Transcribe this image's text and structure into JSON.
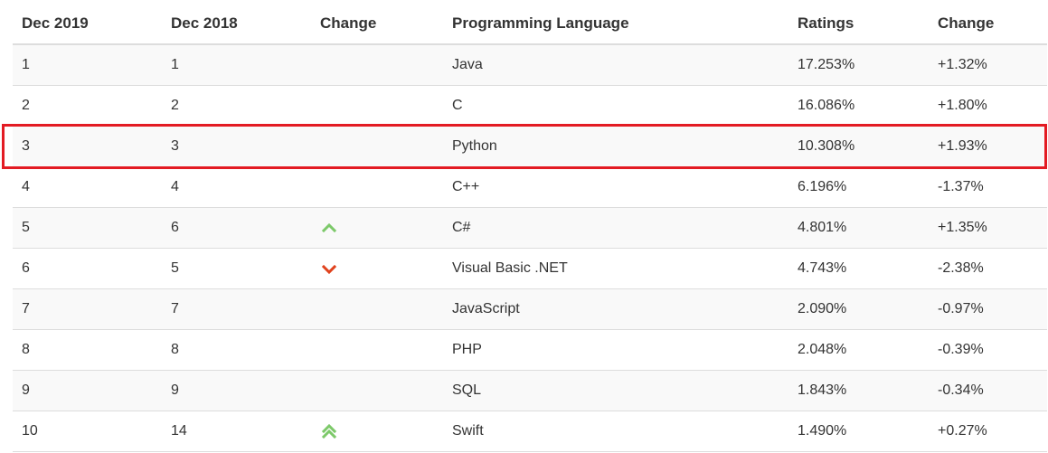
{
  "header": {
    "col1": "Dec 2019",
    "col2": "Dec 2018",
    "col3": "Change",
    "col4": "Programming Language",
    "col5": "Ratings",
    "col6": "Change"
  },
  "colors": {
    "highlight_border": "#e31b23",
    "up_arrow": "#7dc96a",
    "down_arrow": "#e0421d"
  },
  "rows": [
    {
      "rank2019": "1",
      "rank2018": "1",
      "trend": "none",
      "language": "Java",
      "rating": "17.253%",
      "change": "+1.32%"
    },
    {
      "rank2019": "2",
      "rank2018": "2",
      "trend": "none",
      "language": "C",
      "rating": "16.086%",
      "change": "+1.80%"
    },
    {
      "rank2019": "3",
      "rank2018": "3",
      "trend": "none",
      "language": "Python",
      "rating": "10.308%",
      "change": "+1.93%",
      "highlighted": true
    },
    {
      "rank2019": "4",
      "rank2018": "4",
      "trend": "none",
      "language": "C++",
      "rating": "6.196%",
      "change": "-1.37%"
    },
    {
      "rank2019": "5",
      "rank2018": "6",
      "trend": "up",
      "language": "C#",
      "rating": "4.801%",
      "change": "+1.35%"
    },
    {
      "rank2019": "6",
      "rank2018": "5",
      "trend": "down",
      "language": "Visual Basic .NET",
      "rating": "4.743%",
      "change": "-2.38%"
    },
    {
      "rank2019": "7",
      "rank2018": "7",
      "trend": "none",
      "language": "JavaScript",
      "rating": "2.090%",
      "change": "-0.97%"
    },
    {
      "rank2019": "8",
      "rank2018": "8",
      "trend": "none",
      "language": "PHP",
      "rating": "2.048%",
      "change": "-0.39%"
    },
    {
      "rank2019": "9",
      "rank2018": "9",
      "trend": "none",
      "language": "SQL",
      "rating": "1.843%",
      "change": "-0.34%"
    },
    {
      "rank2019": "10",
      "rank2018": "14",
      "trend": "double-up",
      "language": "Swift",
      "rating": "1.490%",
      "change": "+0.27%"
    }
  ]
}
